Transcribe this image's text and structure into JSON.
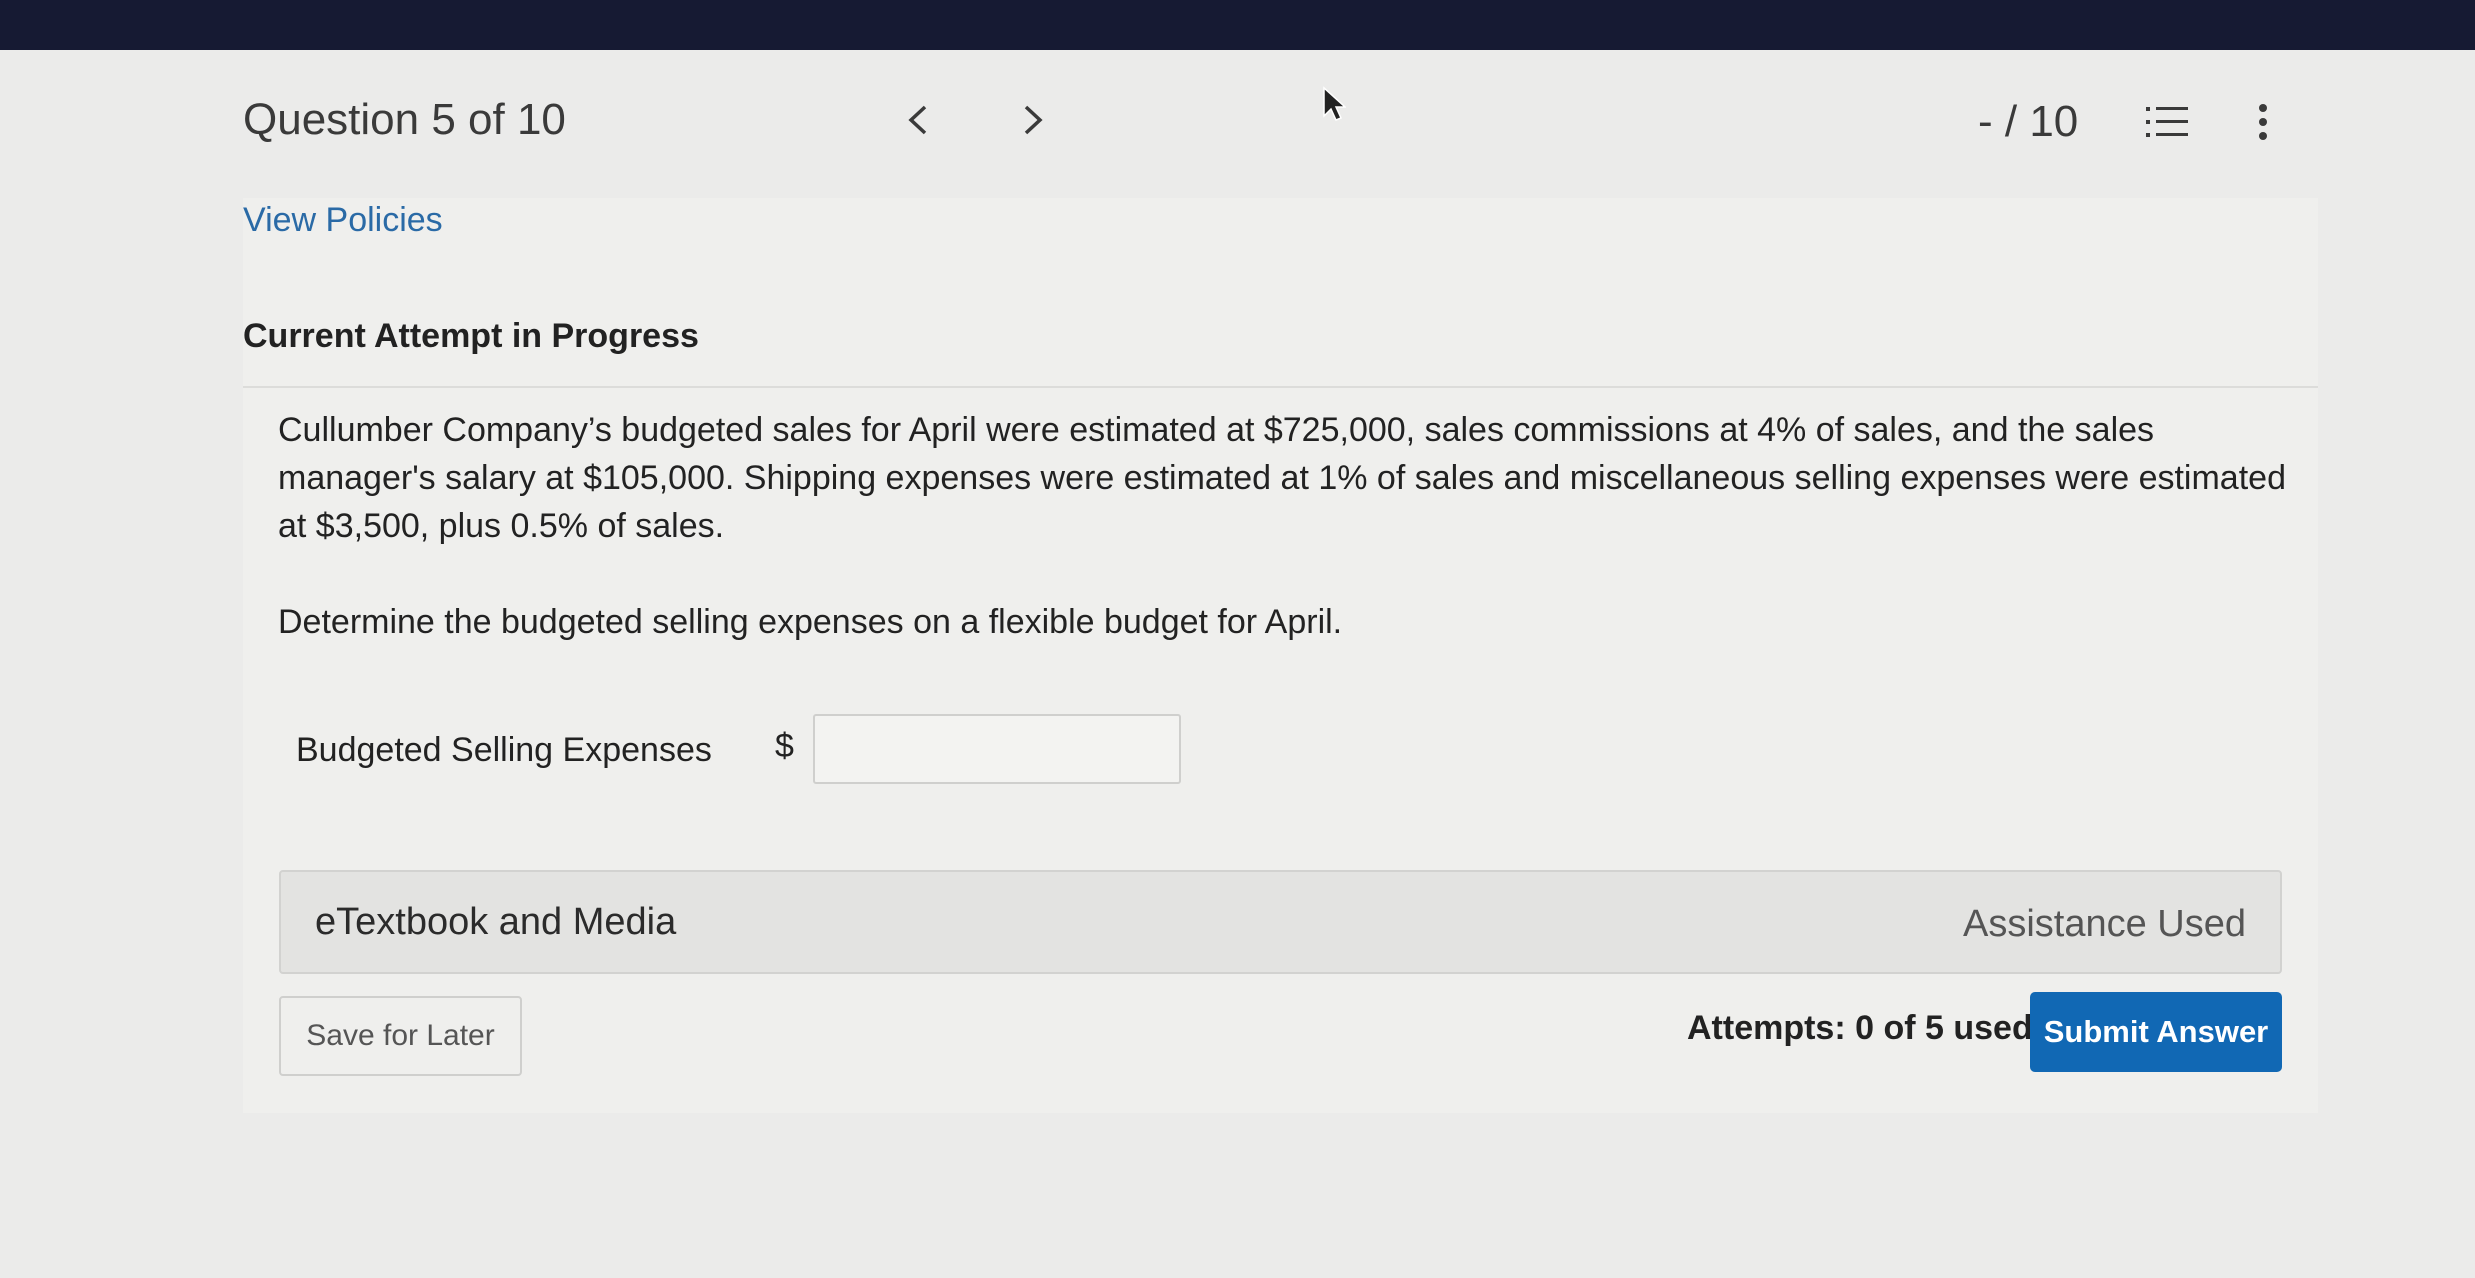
{
  "header": {
    "question_label": "Question 5 of 10",
    "score": "- / 10",
    "prev_icon": "chevron-left-icon",
    "next_icon": "chevron-right-icon",
    "list_icon": "numbered-list-icon",
    "more_icon": "more-vertical-icon"
  },
  "links": {
    "view_policies": "View Policies"
  },
  "attempt": {
    "heading": "Current Attempt in Progress"
  },
  "problem": {
    "text": "Cullumber Company’s budgeted sales for April were estimated at $725,000, sales commissions at 4% of sales, and the sales manager's salary at $105,000. Shipping expenses were estimated at 1% of sales and miscellaneous selling expenses were estimated at $3,500, plus 0.5% of sales.",
    "question": "Determine the budgeted selling expenses on a flexible budget for April."
  },
  "answer": {
    "label": "Budgeted Selling Expenses",
    "currency": "$",
    "value": ""
  },
  "resources": {
    "etextbook_label": "eTextbook and Media",
    "assistance_label": "Assistance Used"
  },
  "footer": {
    "save_label": "Save for Later",
    "attempts_text": "Attempts: 0 of 5 used",
    "submit_label": "Submit Answer"
  },
  "colors": {
    "top_bar": "#161a33",
    "link": "#2a6aa6",
    "submit": "#1168b4",
    "background": "#ebebea"
  }
}
